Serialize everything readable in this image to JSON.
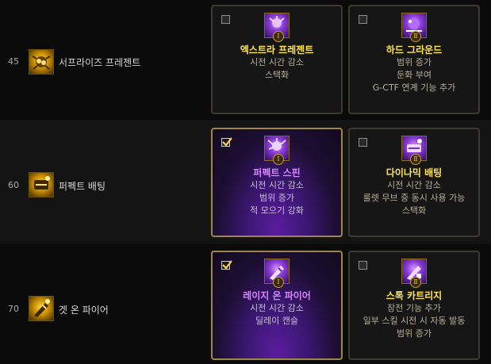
{
  "rows": [
    {
      "level": "45",
      "skill_name": "서프라이즈 프레젠트",
      "skill_icon": "gift-explosion-icon",
      "options": [
        {
          "selected": false,
          "numeral": "Ⅰ",
          "title": "엑스트라 프레젠트",
          "desc": [
            "시전 시간 감소",
            "스택화"
          ]
        },
        {
          "selected": false,
          "numeral": "Ⅱ",
          "title": "하드 그라운드",
          "desc": [
            "범위 증가",
            "둔화 부여",
            "G-CTF 연계 기능 추가"
          ]
        }
      ]
    },
    {
      "level": "60",
      "skill_name": "퍼펙트 배팅",
      "skill_icon": "perfect-bet-icon",
      "options": [
        {
          "selected": true,
          "numeral": "Ⅰ",
          "title": "퍼펙트 스핀",
          "desc": [
            "시전 시간 감소",
            "범위 증가",
            "적 모으기 강화"
          ]
        },
        {
          "selected": false,
          "numeral": "Ⅱ",
          "title": "다이나믹 배팅",
          "desc": [
            "시전 시간 감소",
            "룰렛 무브 중 동시 사용 가능",
            "스택화"
          ]
        }
      ]
    },
    {
      "level": "70",
      "skill_name": "겟 온 파이어",
      "skill_icon": "get-on-fire-icon",
      "options": [
        {
          "selected": true,
          "numeral": "Ⅰ",
          "title": "레이지 온 파이어",
          "desc": [
            "시전 시간 감소",
            "딜레이 캔슬"
          ]
        },
        {
          "selected": false,
          "numeral": "Ⅱ",
          "title": "스톡 카트리지",
          "desc": [
            "장전 기능 추가",
            "일부 스킬 시전 시 자동 발동",
            "범위 증가"
          ]
        }
      ]
    }
  ]
}
